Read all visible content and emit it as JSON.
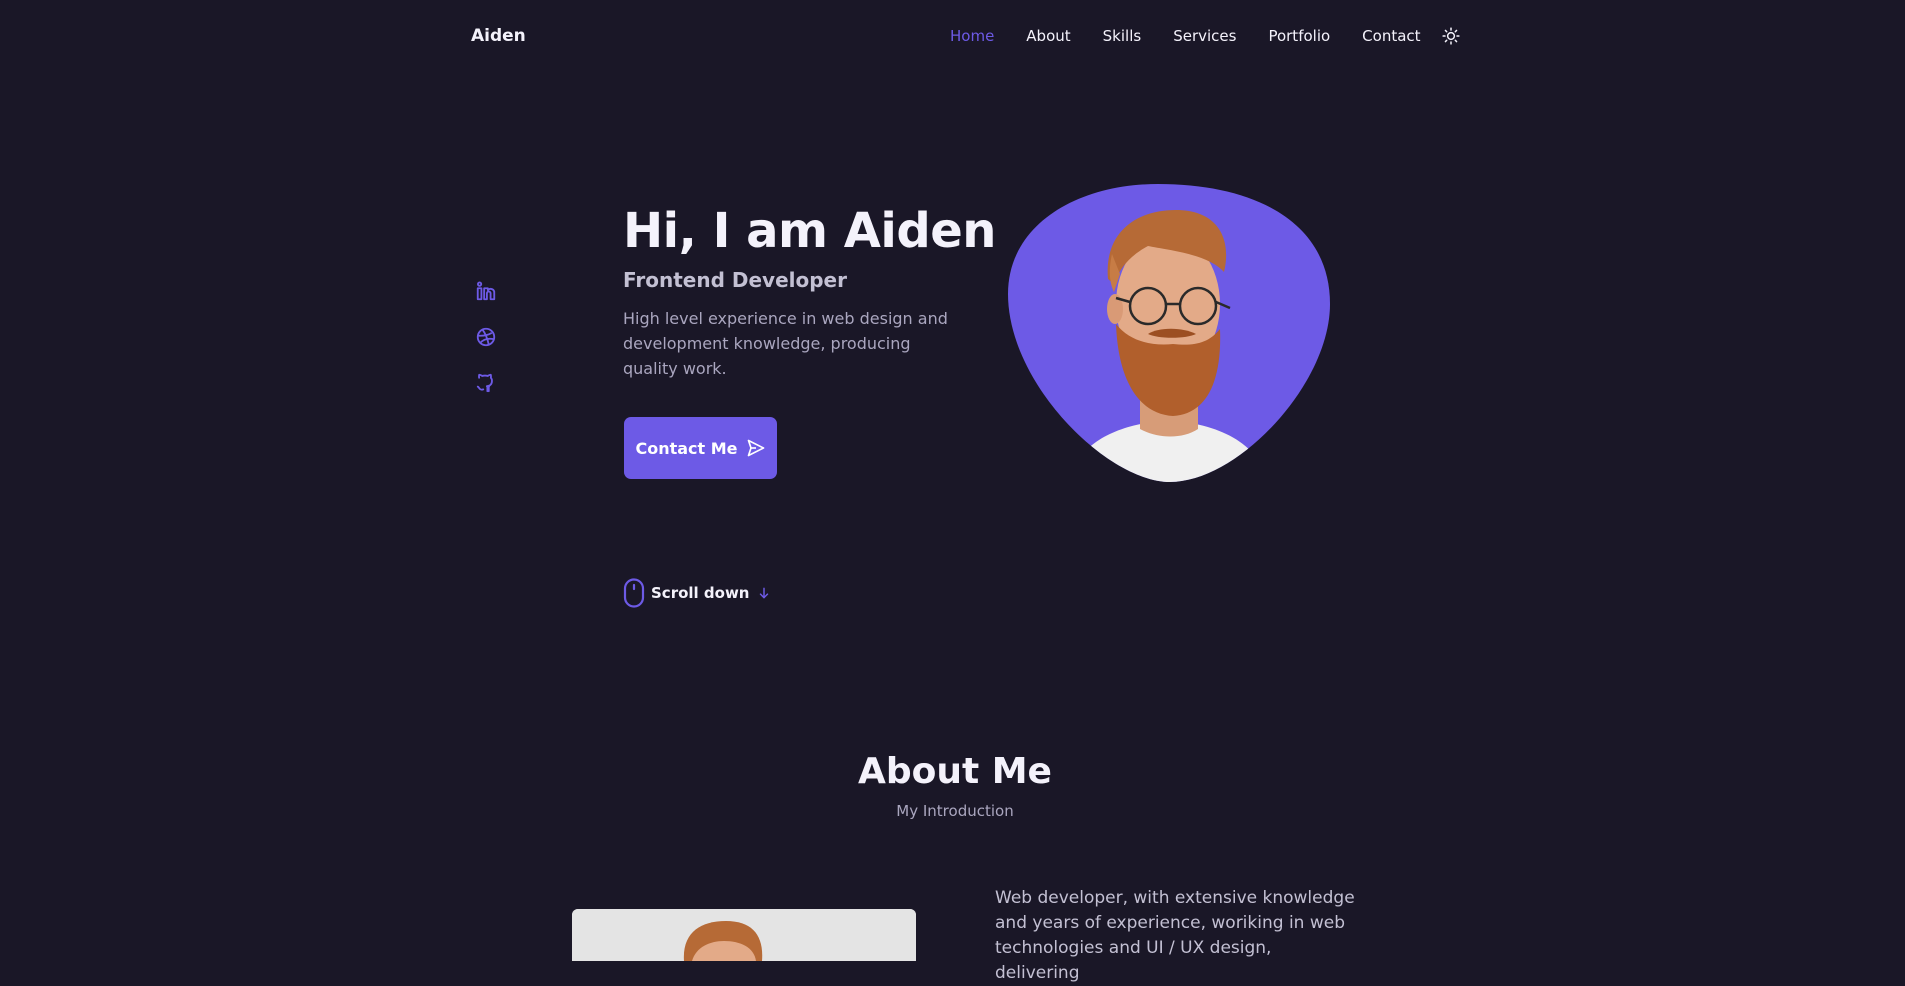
{
  "header": {
    "logo": "Aiden",
    "nav": [
      "Home",
      "About",
      "Skills",
      "Services",
      "Portfolio",
      "Contact"
    ],
    "active_nav": "Home",
    "theme_icon": "sun-icon"
  },
  "social": {
    "icons": [
      "linkedin-icon",
      "dribbble-icon",
      "github-icon"
    ]
  },
  "hero": {
    "title": "Hi, I am Aiden",
    "subtitle": "Frontend Developer",
    "description": "High level experience in web design and development knowledge, producing quality work.",
    "button_label": "Contact Me",
    "button_icon": "send-icon"
  },
  "scroll": {
    "label": "Scroll down",
    "icon": "mouse-icon",
    "arrow_icon": "arrow-down-icon"
  },
  "about": {
    "title": "About Me",
    "subtitle": "My Introduction",
    "description": "Web developer, with extensive knowledge and years of experience, woriking in web technologies and UI / UX design, delivering"
  },
  "colors": {
    "background": "#1a1727",
    "accent": "#6d5ae6",
    "title": "#f4f2fb",
    "text": "#aaa6bf"
  }
}
